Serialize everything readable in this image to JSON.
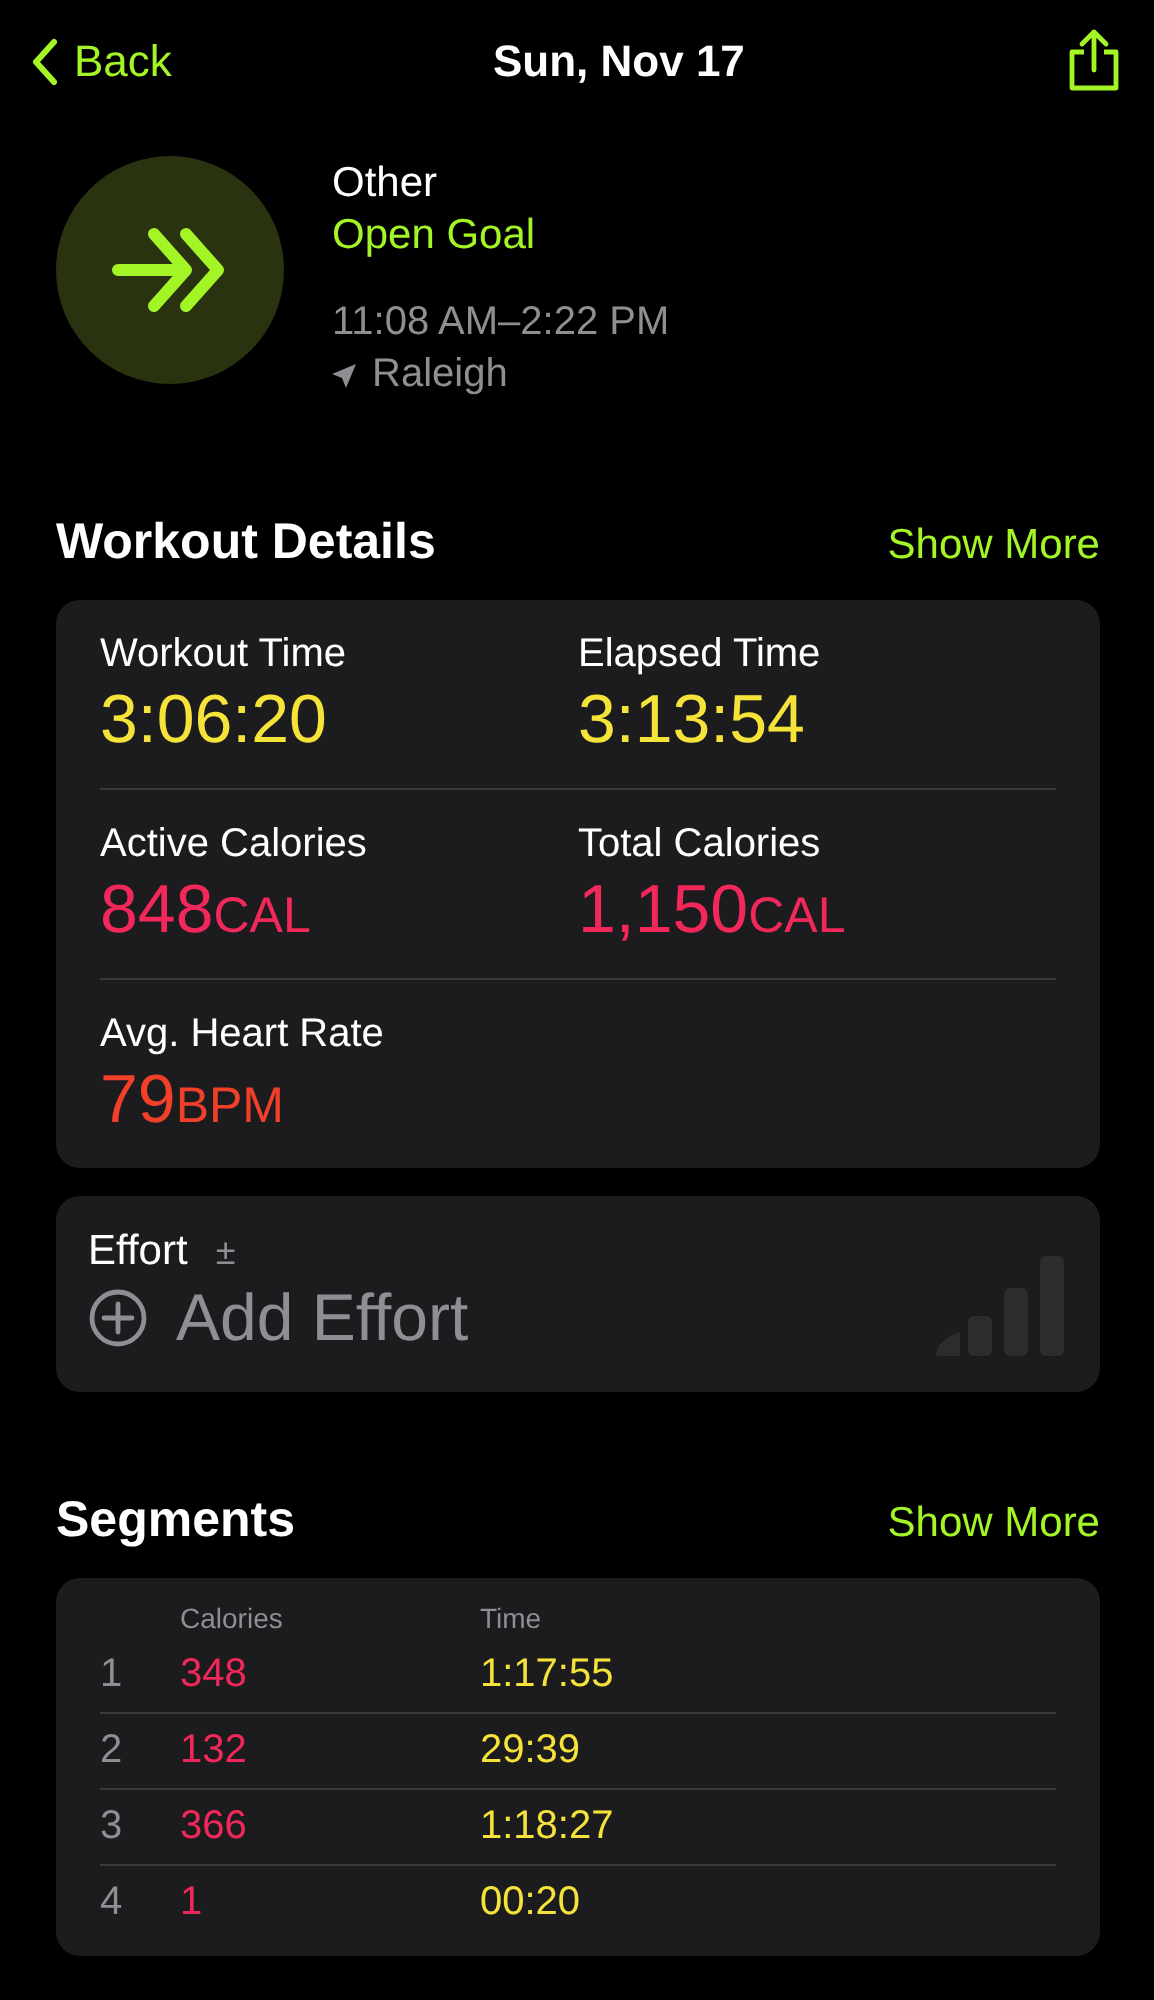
{
  "nav": {
    "back": "Back",
    "title": "Sun, Nov 17"
  },
  "workout": {
    "type": "Other",
    "goal": "Open Goal",
    "time_range": "11:08 AM–2:22 PM",
    "location": "Raleigh"
  },
  "details": {
    "title": "Workout Details",
    "action": "Show More",
    "metrics": [
      {
        "label": "Workout Time",
        "value": "3:06:20",
        "color": "#f5e33a"
      },
      {
        "label": "Elapsed Time",
        "value": "3:13:54",
        "color": "#f5e33a"
      },
      {
        "label": "Active Calories",
        "value": "848",
        "unit": "CAL",
        "color": "#f2285a"
      },
      {
        "label": "Total Calories",
        "value": "1,150",
        "unit": "CAL",
        "color": "#f2285a"
      },
      {
        "label": "Avg. Heart Rate",
        "value": "79",
        "unit": "BPM",
        "color": "#f0402a"
      }
    ]
  },
  "effort": {
    "label": "Effort",
    "symbol": "±",
    "action": "Add Effort"
  },
  "segments": {
    "title": "Segments",
    "action": "Show More",
    "columns": [
      "Calories",
      "Time"
    ],
    "rows": [
      {
        "index": "1",
        "calories": "348",
        "time": "1:17:55"
      },
      {
        "index": "2",
        "calories": "132",
        "time": "29:39"
      },
      {
        "index": "3",
        "calories": "366",
        "time": "1:18:27"
      },
      {
        "index": "4",
        "calories": "1",
        "time": "00:20"
      }
    ]
  }
}
